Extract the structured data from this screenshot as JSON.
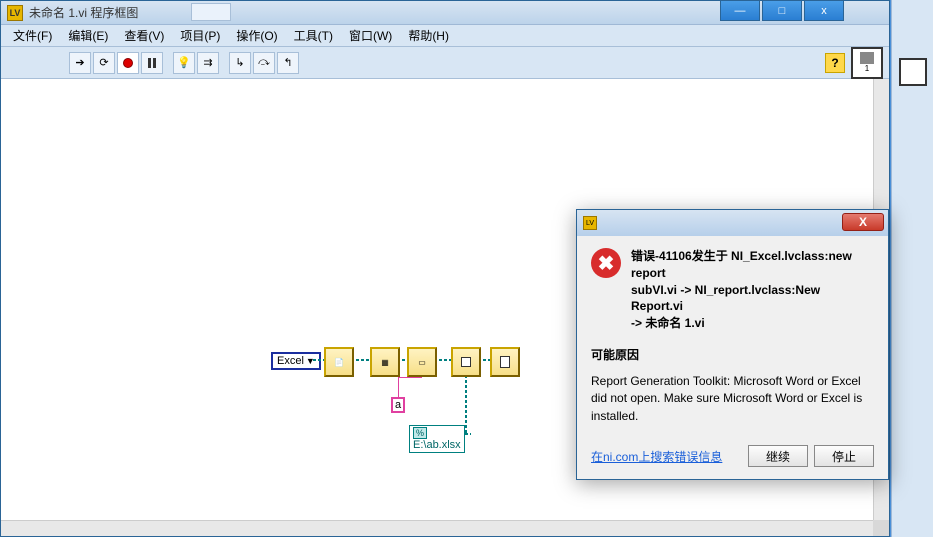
{
  "main_window": {
    "title": "未命名 1.vi 程序框图",
    "win_buttons": {
      "min": "—",
      "max": "□",
      "close": "x"
    }
  },
  "menu": {
    "file": "文件(F)",
    "edit": "编辑(E)",
    "view": "查看(V)",
    "project": "项目(P)",
    "operate": "操作(O)",
    "tools": "工具(T)",
    "window": "窗口(W)",
    "help": "帮助(H)"
  },
  "toolbar": {
    "run": "▶",
    "run_cont": "⟳",
    "pause": "II",
    "bulb": "💡",
    "highlight": "⇉",
    "step_into": "↳",
    "step_over": "⤼",
    "step_out": "↰",
    "help": "?"
  },
  "block_diagram": {
    "excel_const": "Excel",
    "excel_dd": "▼",
    "const_a": "a",
    "path_tag": "%",
    "path_value": "E:\\ab.xlsx"
  },
  "error_dialog": {
    "title_line1": "错误-41106发生于 NI_Excel.lvclass:new report",
    "title_line2": "subVI.vi -> NI_report.lvclass:New Report.vi",
    "title_line3": "-> 未命名 1.vi",
    "reason_head": "可能原因",
    "reason_text": "Report Generation Toolkit: Microsoft Word or Excel did not open. Make sure Microsoft Word or Excel is installed.",
    "link": "在ni.com上搜索错误信息",
    "continue": "继续",
    "stop": "停止",
    "close_x": "X",
    "err_glyph": "✖"
  }
}
